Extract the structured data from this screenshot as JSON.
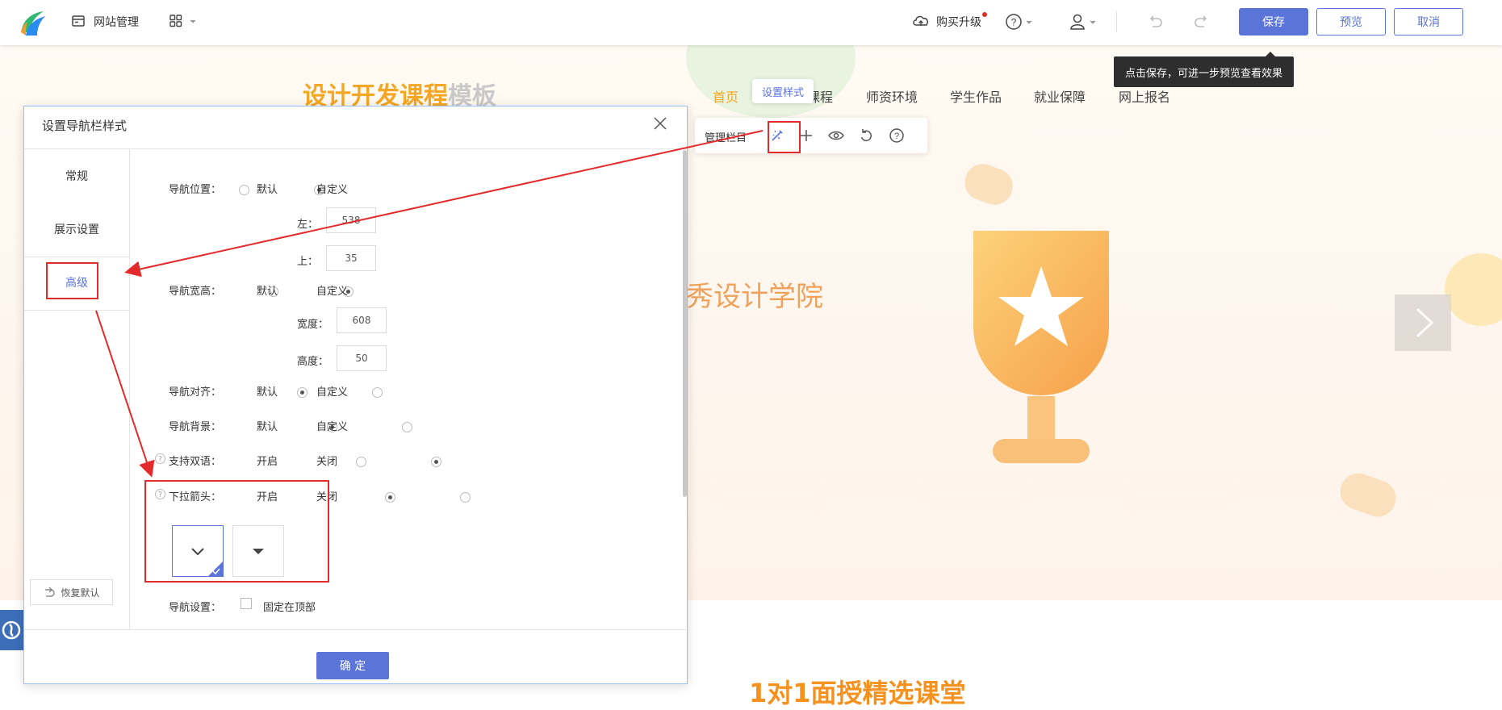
{
  "topbar": {
    "site_manage": "网站管理",
    "buy_upgrade": "购买升级",
    "save": "保存",
    "preview": "预览",
    "cancel": "取消",
    "save_tooltip": "点击保存，可进一步预览查看效果"
  },
  "site": {
    "logo_text_orange": "设计开发课程",
    "logo_text_gray": "模板",
    "nav": [
      "首页",
      "课程",
      "师资环境",
      "学生作品",
      "就业保障",
      "网上报名"
    ],
    "set_style_tip": "设置样式",
    "manage_label": "管理栏目",
    "hero_text": "秀设计学院",
    "section_title": "1对1面授精选课堂"
  },
  "dialog": {
    "title": "设置导航栏样式",
    "tabs": [
      "常规",
      "展示设置",
      "高级"
    ],
    "restore": "恢复默认",
    "confirm": "确 定",
    "nav_position": {
      "label": "导航位置：",
      "opt_default": "默认",
      "opt_custom": "自定义",
      "left_label": "左：",
      "left_value": "538",
      "top_label": "上：",
      "top_value": "35"
    },
    "nav_size": {
      "label": "导航宽高：",
      "opt_default": "默认",
      "opt_custom": "自定义",
      "width_label": "宽度：",
      "width_value": "608",
      "height_label": "高度：",
      "height_value": "50"
    },
    "nav_align": {
      "label": "导航对齐：",
      "opt_default": "默认",
      "opt_custom": "自定义"
    },
    "nav_bg": {
      "label": "导航背景：",
      "opt_default": "默认",
      "opt_custom": "自定义"
    },
    "bilingual": {
      "label": "支持双语：",
      "opt_on": "开启",
      "opt_off": "关闭"
    },
    "dropdown_arrow": {
      "label": "下拉箭头：",
      "opt_on": "开启",
      "opt_off": "关闭"
    },
    "nav_setting": {
      "label": "导航设置：",
      "fixed_top": "固定在顶部"
    }
  },
  "colors": {
    "accent": "#5a74d8",
    "orange": "#f5a623",
    "red_annotation": "#e32b2b"
  }
}
